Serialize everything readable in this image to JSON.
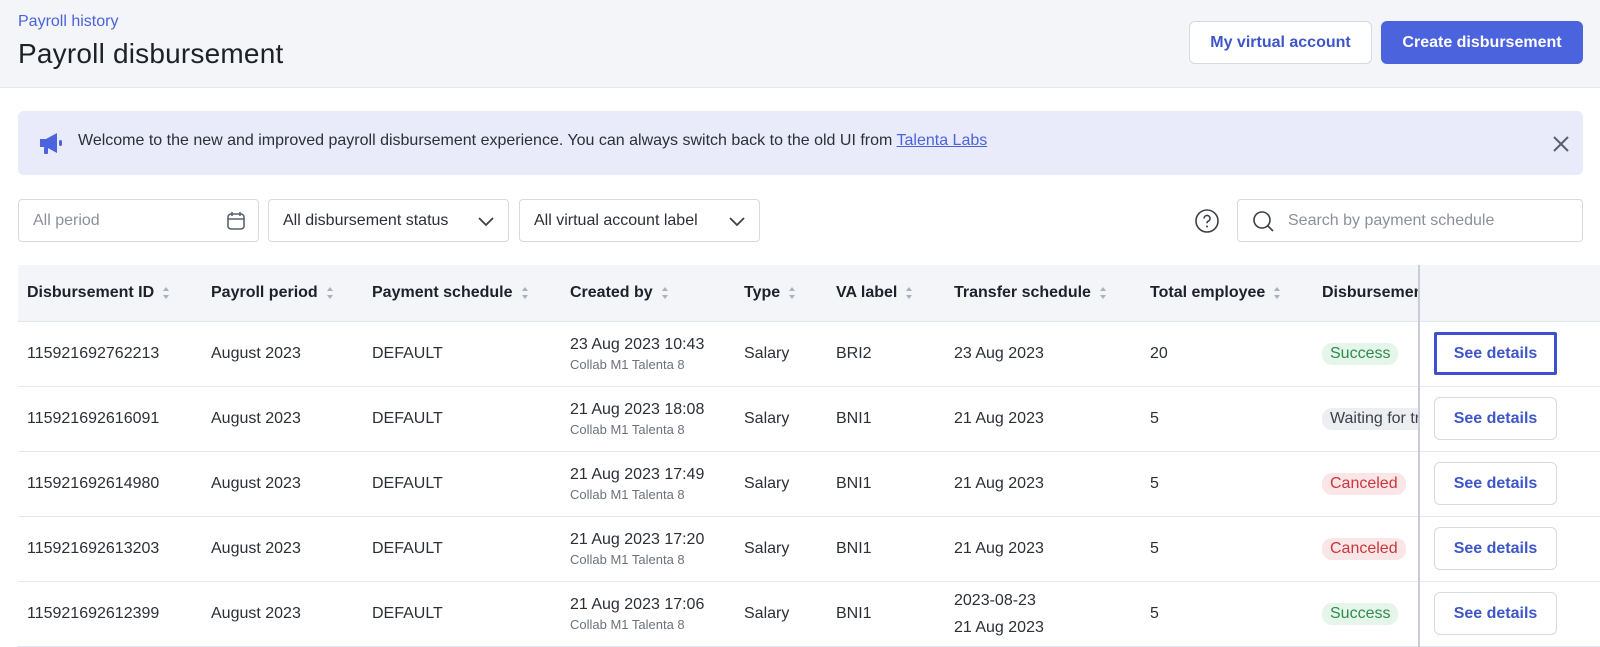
{
  "header": {
    "breadcrumb": "Payroll history",
    "title": "Payroll disbursement",
    "my_va_label": "My virtual account",
    "create_label": "Create disbursement"
  },
  "banner": {
    "text": "Welcome to the new and improved payroll disbursement experience. You can always switch back to the old UI from ",
    "link": "Talenta Labs"
  },
  "filters": {
    "period_placeholder": "All period",
    "status": "All disbursement status",
    "va_label": "All virtual account label",
    "search_placeholder": "Search by payment schedule"
  },
  "table": {
    "columns": [
      "Disbursement ID",
      "Payroll period",
      "Payment schedule",
      "Created by",
      "Type",
      "VA label",
      "Transfer schedule",
      "Total employee",
      "Disbursement"
    ],
    "action_label": "See details",
    "rows": [
      {
        "id": "115921692762213",
        "period": "August 2023",
        "schedule": "DEFAULT",
        "created": "23 Aug 2023 10:43",
        "creator": "Collab M1 Talenta 8",
        "type": "Salary",
        "va": "BRI2",
        "transfer": "",
        "transfer_main": "23 Aug 2023",
        "total": "20",
        "status": "Success",
        "status_kind": "success"
      },
      {
        "id": "115921692616091",
        "period": "August 2023",
        "schedule": "DEFAULT",
        "created": "21 Aug 2023 18:08",
        "creator": "Collab M1 Talenta 8",
        "type": "Salary",
        "va": "BNI1",
        "transfer": "",
        "transfer_main": "21 Aug 2023",
        "total": "5",
        "status": "Waiting for tr",
        "status_kind": "waiting"
      },
      {
        "id": "115921692614980",
        "period": "August 2023",
        "schedule": "DEFAULT",
        "created": "21 Aug 2023 17:49",
        "creator": "Collab M1 Talenta 8",
        "type": "Salary",
        "va": "BNI1",
        "transfer": "",
        "transfer_main": "21 Aug 2023",
        "total": "5",
        "status": "Canceled",
        "status_kind": "canceled"
      },
      {
        "id": "115921692613203",
        "period": "August 2023",
        "schedule": "DEFAULT",
        "created": "21 Aug 2023 17:20",
        "creator": "Collab M1 Talenta 8",
        "type": "Salary",
        "va": "BNI1",
        "transfer": "",
        "transfer_main": "21 Aug 2023",
        "total": "5",
        "status": "Canceled",
        "status_kind": "canceled"
      },
      {
        "id": "115921692612399",
        "period": "August 2023",
        "schedule": "DEFAULT",
        "created": "21 Aug 2023 17:06",
        "creator": "Collab M1 Talenta 8",
        "type": "Salary",
        "va": "BNI1",
        "transfer": "2023-08-23",
        "transfer_main": "21 Aug 2023",
        "total": "5",
        "status": "Success",
        "status_kind": "success"
      }
    ]
  }
}
